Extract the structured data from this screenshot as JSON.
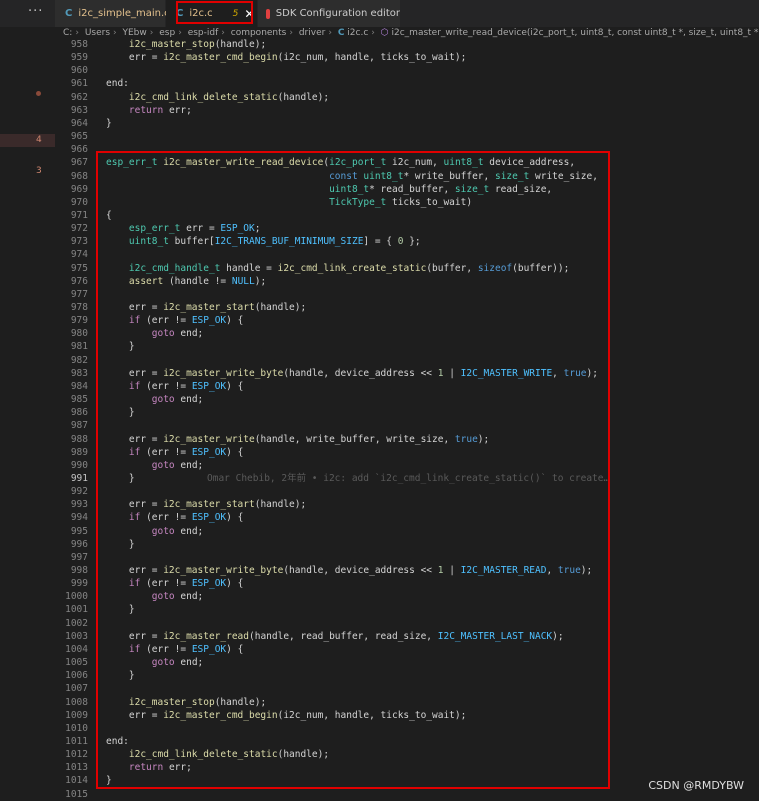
{
  "tabs": [
    {
      "label": "i2c_simple_main.c",
      "count": "4"
    },
    {
      "label": "i2c.c",
      "count": "5"
    },
    {
      "label": "SDK Configuration editor"
    }
  ],
  "breadcrumb": [
    "C:",
    "Users",
    "YEbw",
    "esp",
    "esp-idf",
    "components",
    "driver",
    "i2c.c",
    "i2c_master_write_read_device(i2c_port_t, uint8_t, const uint8_t *, size_t, uint8_t *, size_t, TickType_t)"
  ],
  "margin_markers": {
    "m4": "4",
    "m3": "3"
  },
  "blame": "Omar Chebib, 2年前 • i2c: add `i2c_cmd_link_create_static()` to create…",
  "watermark": "CSDN @RMDYBW",
  "lines": [
    {
      "n": "958",
      "t": "    i2c_master_stop(handle);"
    },
    {
      "n": "959",
      "t": "    err = i2c_master_cmd_begin(i2c_num, handle, ticks_to_wait);"
    },
    {
      "n": "960",
      "t": ""
    },
    {
      "n": "961",
      "t": "end:"
    },
    {
      "n": "962",
      "t": "    i2c_cmd_link_delete_static(handle);"
    },
    {
      "n": "963",
      "t": "    return err;"
    },
    {
      "n": "964",
      "t": "}"
    },
    {
      "n": "965",
      "t": ""
    },
    {
      "n": "966",
      "t": ""
    },
    {
      "n": "967",
      "t": "esp_err_t i2c_master_write_read_device(i2c_port_t i2c_num, uint8_t device_address,"
    },
    {
      "n": "968",
      "t": "                                       const uint8_t* write_buffer, size_t write_size,"
    },
    {
      "n": "969",
      "t": "                                       uint8_t* read_buffer, size_t read_size,"
    },
    {
      "n": "970",
      "t": "                                       TickType_t ticks_to_wait)"
    },
    {
      "n": "971",
      "t": "{"
    },
    {
      "n": "972",
      "t": "    esp_err_t err = ESP_OK;"
    },
    {
      "n": "973",
      "t": "    uint8_t buffer[I2C_TRANS_BUF_MINIMUM_SIZE] = { 0 };"
    },
    {
      "n": "974",
      "t": ""
    },
    {
      "n": "975",
      "t": "    i2c_cmd_handle_t handle = i2c_cmd_link_create_static(buffer, sizeof(buffer));"
    },
    {
      "n": "976",
      "t": "    assert (handle != NULL);"
    },
    {
      "n": "977",
      "t": ""
    },
    {
      "n": "978",
      "t": "    err = i2c_master_start(handle);"
    },
    {
      "n": "979",
      "t": "    if (err != ESP_OK) {"
    },
    {
      "n": "980",
      "t": "        goto end;"
    },
    {
      "n": "981",
      "t": "    }"
    },
    {
      "n": "982",
      "t": ""
    },
    {
      "n": "983",
      "t": "    err = i2c_master_write_byte(handle, device_address << 1 | I2C_MASTER_WRITE, true);"
    },
    {
      "n": "984",
      "t": "    if (err != ESP_OK) {"
    },
    {
      "n": "985",
      "t": "        goto end;"
    },
    {
      "n": "986",
      "t": "    }"
    },
    {
      "n": "987",
      "t": ""
    },
    {
      "n": "988",
      "t": "    err = i2c_master_write(handle, write_buffer, write_size, true);"
    },
    {
      "n": "989",
      "t": "    if (err != ESP_OK) {"
    },
    {
      "n": "990",
      "t": "        goto end;"
    },
    {
      "n": "991",
      "t": "    }"
    },
    {
      "n": "992",
      "t": ""
    },
    {
      "n": "993",
      "t": "    err = i2c_master_start(handle);"
    },
    {
      "n": "994",
      "t": "    if (err != ESP_OK) {"
    },
    {
      "n": "995",
      "t": "        goto end;"
    },
    {
      "n": "996",
      "t": "    }"
    },
    {
      "n": "997",
      "t": ""
    },
    {
      "n": "998",
      "t": "    err = i2c_master_write_byte(handle, device_address << 1 | I2C_MASTER_READ, true);"
    },
    {
      "n": "999",
      "t": "    if (err != ESP_OK) {"
    },
    {
      "n": "1000",
      "t": "        goto end;"
    },
    {
      "n": "1001",
      "t": "    }"
    },
    {
      "n": "1002",
      "t": ""
    },
    {
      "n": "1003",
      "t": "    err = i2c_master_read(handle, read_buffer, read_size, I2C_MASTER_LAST_NACK);"
    },
    {
      "n": "1004",
      "t": "    if (err != ESP_OK) {"
    },
    {
      "n": "1005",
      "t": "        goto end;"
    },
    {
      "n": "1006",
      "t": "    }"
    },
    {
      "n": "1007",
      "t": ""
    },
    {
      "n": "1008",
      "t": "    i2c_master_stop(handle);"
    },
    {
      "n": "1009",
      "t": "    err = i2c_master_cmd_begin(i2c_num, handle, ticks_to_wait);"
    },
    {
      "n": "1010",
      "t": ""
    },
    {
      "n": "1011",
      "t": "end:"
    },
    {
      "n": "1012",
      "t": "    i2c_cmd_link_delete_static(handle);"
    },
    {
      "n": "1013",
      "t": "    return err;"
    },
    {
      "n": "1014",
      "t": "}"
    },
    {
      "n": "1015",
      "t": ""
    }
  ]
}
